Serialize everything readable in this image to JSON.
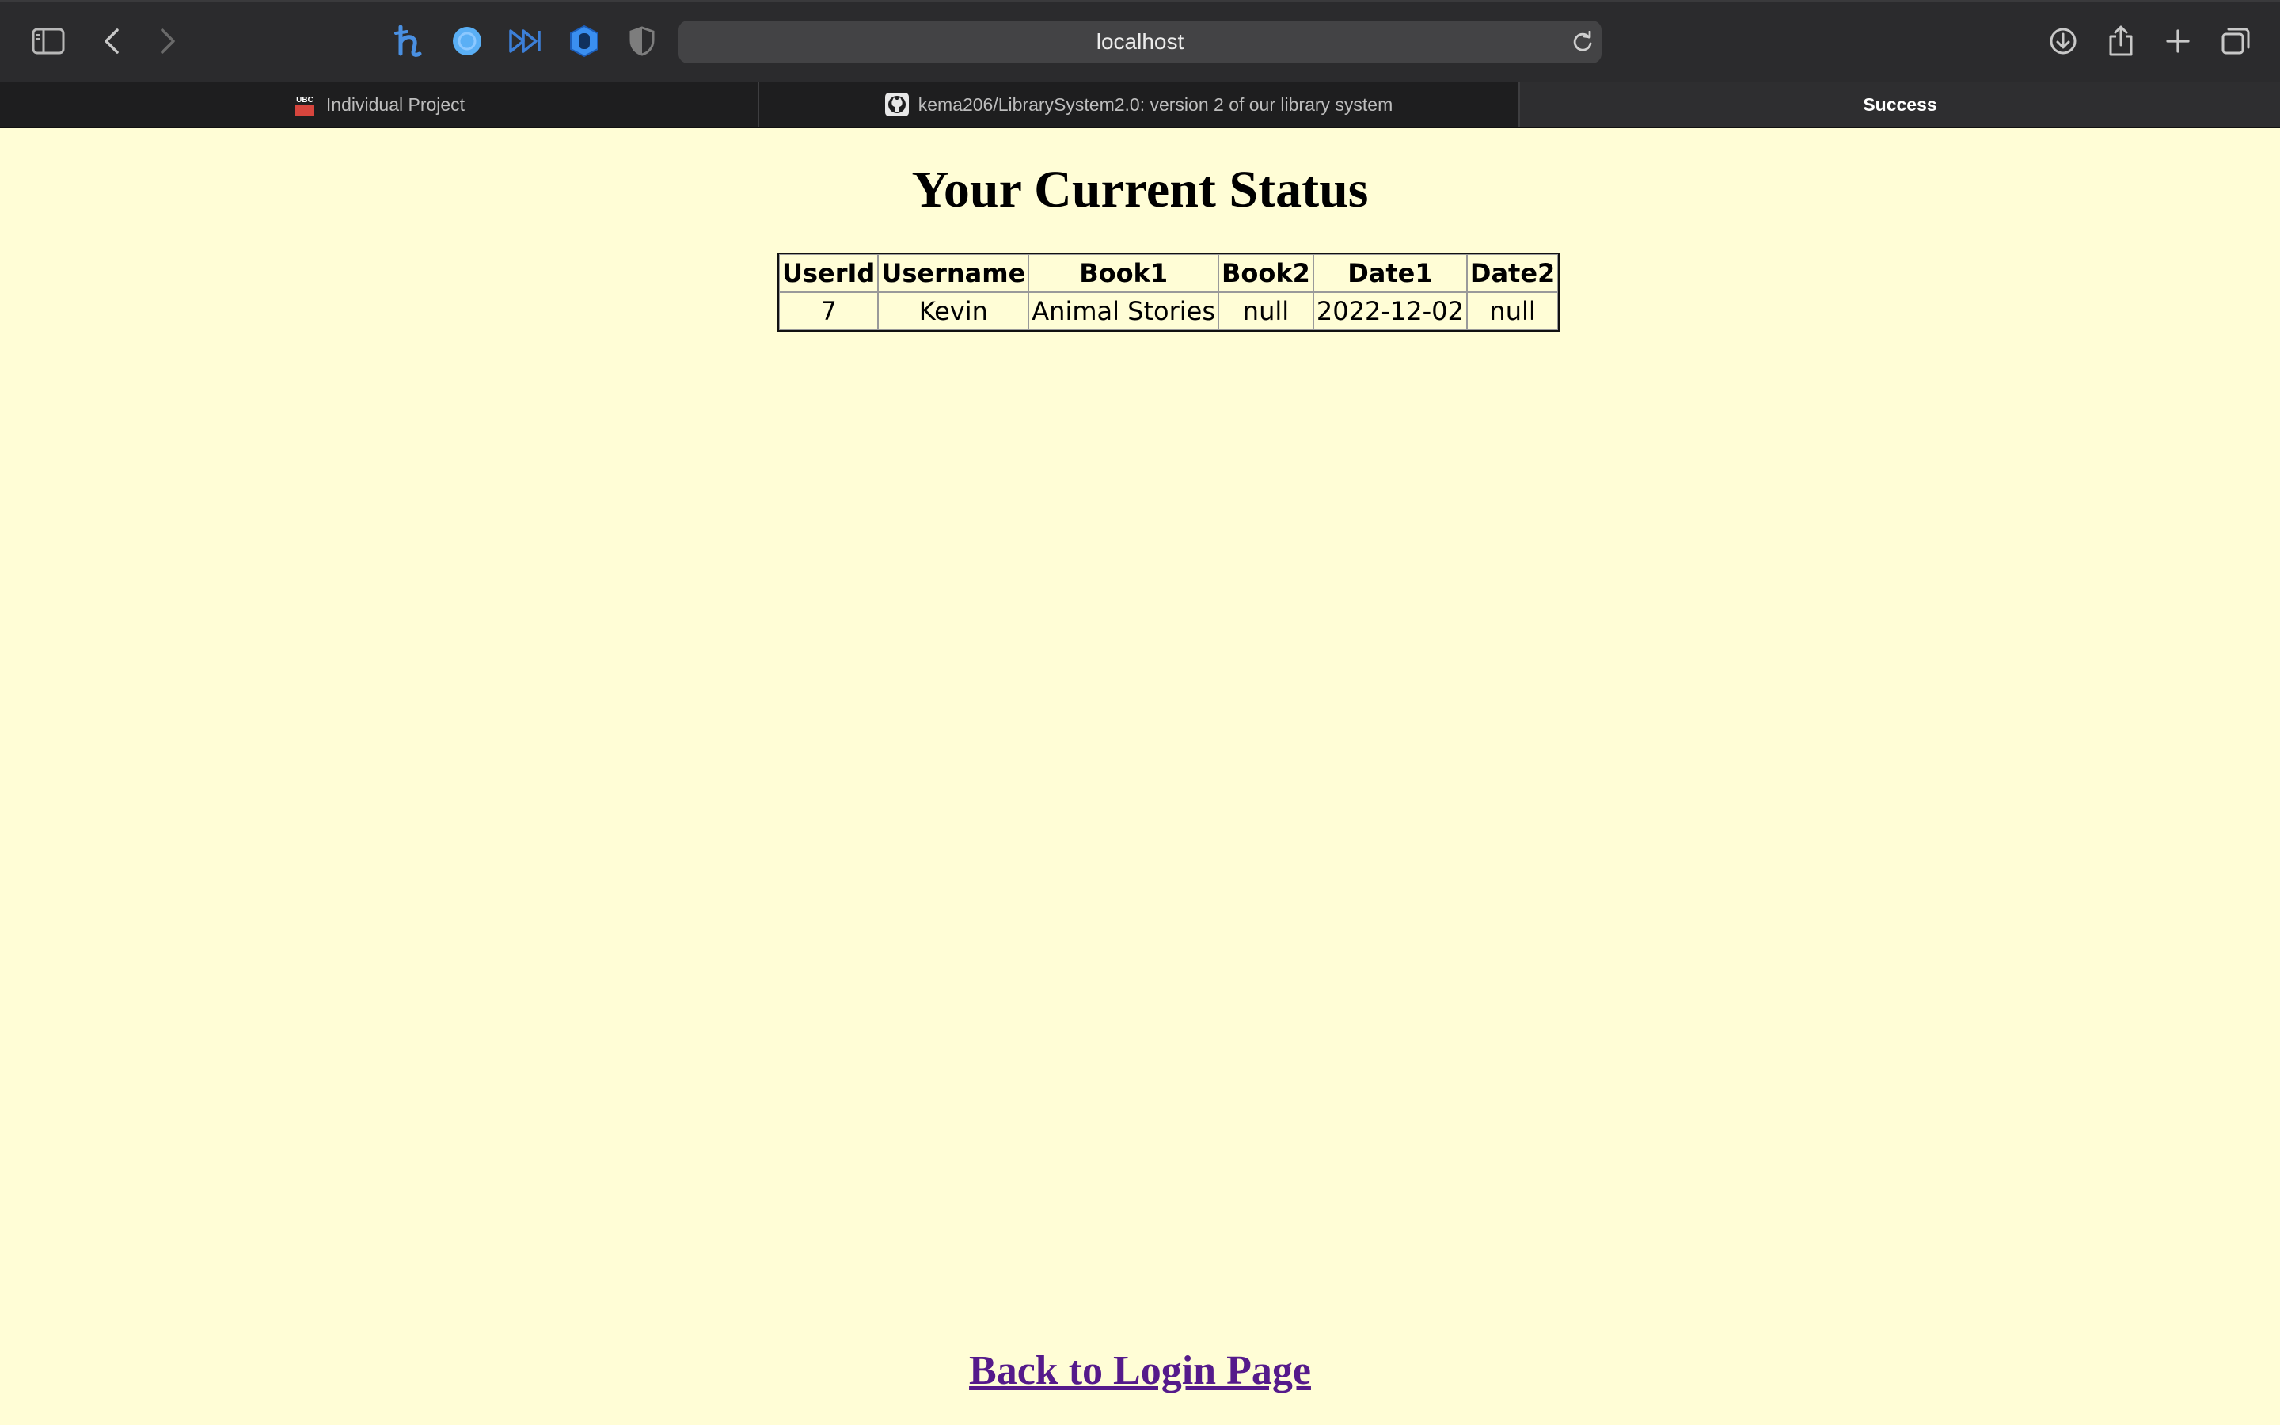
{
  "browser": {
    "url": "localhost",
    "tabs": [
      {
        "label": "Individual Project",
        "favicon": "ubc-logo-icon",
        "active": false
      },
      {
        "label": "kema206/LibrarySystem2.0: version 2 of our library system",
        "favicon": "github-icon",
        "active": false
      },
      {
        "label": "Success",
        "favicon": "",
        "active": true
      }
    ],
    "favicon_ubc_text": "UBC",
    "accent": "#4a90e2"
  },
  "page": {
    "title": "Your Current Status",
    "table": {
      "headers": [
        "UserId",
        "Username",
        "Book1",
        "Book2",
        "Date1",
        "Date2"
      ],
      "rows": [
        [
          "7",
          "Kevin",
          "Animal Stories",
          "null",
          "2022-12-02",
          "null"
        ]
      ]
    },
    "back_link": "Back to Login Page",
    "background": "#fffdd6",
    "link_color": "#551a8b"
  }
}
